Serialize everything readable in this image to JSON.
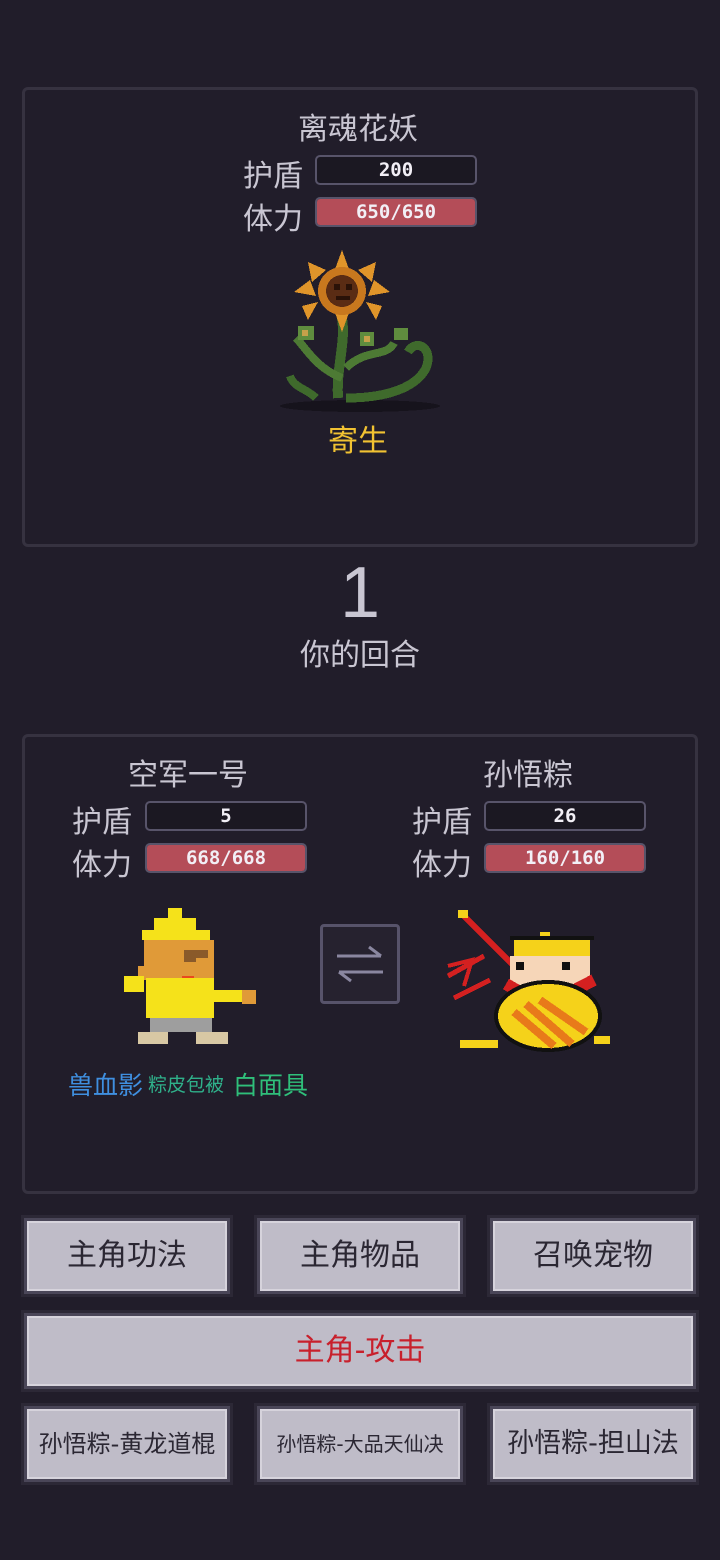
{
  "enemy": {
    "name": "离魂花妖",
    "shield_label": "护盾",
    "shield_value": "200",
    "hp_label": "体力",
    "hp_text": "650/650",
    "hp_fraction": 1.0,
    "status": "寄生",
    "sprite_icon": "sunflower-monster-icon"
  },
  "turn": {
    "number": "1",
    "label": "你的回合"
  },
  "hero": {
    "name": "空军一号",
    "shield_label": "护盾",
    "shield_value": "5",
    "hp_label": "体力",
    "hp_text": "668/668",
    "hp_fraction": 1.0,
    "sprite_icon": "yellow-hooded-hero-icon",
    "buffs": [
      {
        "text": "兽血影",
        "color": "#3f8fe0"
      },
      {
        "text": "粽皮包被",
        "color": "#2fb08a"
      },
      {
        "text": "白面具",
        "color": "#2fbf7a"
      }
    ]
  },
  "pet": {
    "name": "孙悟粽",
    "shield_label": "护盾",
    "shield_value": "26",
    "hp_label": "体力",
    "hp_text": "160/160",
    "hp_fraction": 1.0,
    "sprite_icon": "monkey-king-zongzi-icon"
  },
  "swap_icon": "swap-arrows-icon",
  "buttons": {
    "skills": "主角功法",
    "items": "主角物品",
    "summon": "召唤宠物",
    "attack": "主角-攻击",
    "pet_skill_1": "孙悟粽-黄龙道棍",
    "pet_skill_2": "孙悟粽-大品天仙决",
    "pet_skill_3": "孙悟粽-担山法"
  },
  "colors": {
    "background": "#211d2a",
    "hp_fill": "#b44d58",
    "status_yellow": "#f1c232",
    "attack_red": "#c8202c"
  }
}
